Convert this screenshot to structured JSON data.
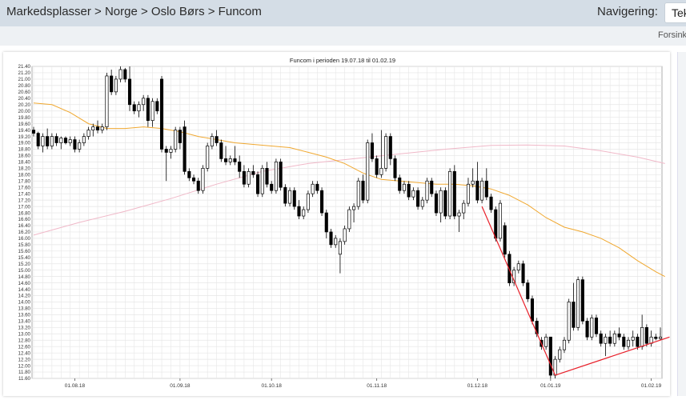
{
  "header": {
    "breadcrumb": "Markedsplasser > Norge > Oslo Børs > Funcom",
    "nav_label": "Navigering:",
    "nav_value": "Tek",
    "sub_link": "Forsink"
  },
  "chart_data": {
    "type": "candlestick",
    "title": "Funcom i perioden 19.07.18 til 01.02.19",
    "ylim": [
      11.6,
      21.4
    ],
    "y_ticks": [
      "11.60",
      "11.80",
      "12.00",
      "12.20",
      "12.40",
      "12.60",
      "12.80",
      "13.00",
      "13.20",
      "13.40",
      "13.60",
      "13.80",
      "14.00",
      "14.20",
      "14.40",
      "14.60",
      "14.80",
      "15.00",
      "15.20",
      "15.40",
      "15.60",
      "15.80",
      "16.00",
      "16.20",
      "16.40",
      "16.60",
      "16.80",
      "17.00",
      "17.20",
      "17.40",
      "17.60",
      "17.80",
      "18.00",
      "18.20",
      "18.40",
      "18.60",
      "18.80",
      "19.00",
      "19.20",
      "19.40",
      "19.60",
      "19.80",
      "20.00",
      "20.20",
      "20.40",
      "20.60",
      "20.80",
      "21.00",
      "21.20",
      "21.40"
    ],
    "x_ticks": [
      {
        "i": 9,
        "label": "01.08.18"
      },
      {
        "i": 32,
        "label": "01.09.18"
      },
      {
        "i": 52,
        "label": "01.10.18"
      },
      {
        "i": 75,
        "label": "01.11.18"
      },
      {
        "i": 97,
        "label": "01.12.18"
      },
      {
        "i": 113,
        "label": "01.01.19"
      },
      {
        "i": 135,
        "label": "01.02.19"
      }
    ],
    "grid": true,
    "colors": {
      "up": "#ffffff",
      "down": "#000000",
      "ma_short": "#f0a830",
      "ma_long": "#f0b8c8",
      "trend": "#e8202a",
      "grid": "#e6e6e6"
    },
    "ohlc": [
      {
        "o": 19.4,
        "h": 19.5,
        "l": 19.2,
        "c": 19.3
      },
      {
        "o": 19.3,
        "h": 19.35,
        "l": 18.8,
        "c": 18.9
      },
      {
        "o": 18.9,
        "h": 19.3,
        "l": 18.7,
        "c": 19.2
      },
      {
        "o": 19.2,
        "h": 19.45,
        "l": 18.8,
        "c": 18.9
      },
      {
        "o": 18.9,
        "h": 19.3,
        "l": 18.8,
        "c": 19.2
      },
      {
        "o": 19.2,
        "h": 19.3,
        "l": 18.9,
        "c": 19.0
      },
      {
        "o": 19.0,
        "h": 19.2,
        "l": 18.8,
        "c": 19.15
      },
      {
        "o": 19.15,
        "h": 19.2,
        "l": 18.95,
        "c": 19.0
      },
      {
        "o": 19.0,
        "h": 19.2,
        "l": 18.9,
        "c": 19.1
      },
      {
        "o": 19.1,
        "h": 19.2,
        "l": 18.7,
        "c": 18.8
      },
      {
        "o": 18.8,
        "h": 19.1,
        "l": 18.7,
        "c": 19.0
      },
      {
        "o": 19.0,
        "h": 19.3,
        "l": 18.9,
        "c": 19.2
      },
      {
        "o": 19.2,
        "h": 19.5,
        "l": 19.1,
        "c": 19.4
      },
      {
        "o": 19.4,
        "h": 19.6,
        "l": 19.2,
        "c": 19.5
      },
      {
        "o": 19.5,
        "h": 19.7,
        "l": 19.3,
        "c": 19.4
      },
      {
        "o": 19.4,
        "h": 19.6,
        "l": 19.3,
        "c": 19.5
      },
      {
        "o": 19.5,
        "h": 21.2,
        "l": 19.4,
        "c": 21.1
      },
      {
        "o": 21.1,
        "h": 21.3,
        "l": 20.5,
        "c": 20.6
      },
      {
        "o": 20.6,
        "h": 21.1,
        "l": 20.5,
        "c": 21.0
      },
      {
        "o": 21.0,
        "h": 21.4,
        "l": 20.9,
        "c": 21.3
      },
      {
        "o": 21.3,
        "h": 21.35,
        "l": 20.9,
        "c": 21.0
      },
      {
        "o": 21.0,
        "h": 21.4,
        "l": 20.0,
        "c": 20.2
      },
      {
        "o": 20.2,
        "h": 20.3,
        "l": 19.9,
        "c": 20.0
      },
      {
        "o": 20.0,
        "h": 20.3,
        "l": 19.8,
        "c": 20.2
      },
      {
        "o": 20.2,
        "h": 20.5,
        "l": 20.0,
        "c": 20.4
      },
      {
        "o": 20.4,
        "h": 20.5,
        "l": 19.5,
        "c": 19.7
      },
      {
        "o": 19.7,
        "h": 20.4,
        "l": 19.5,
        "c": 20.3
      },
      {
        "o": 20.3,
        "h": 20.4,
        "l": 19.9,
        "c": 20.0
      },
      {
        "o": 21.0,
        "h": 21.1,
        "l": 18.7,
        "c": 18.8
      },
      {
        "o": 18.8,
        "h": 18.9,
        "l": 17.8,
        "c": 18.7
      },
      {
        "o": 18.7,
        "h": 18.9,
        "l": 18.5,
        "c": 18.8
      },
      {
        "o": 18.8,
        "h": 19.5,
        "l": 18.7,
        "c": 19.4
      },
      {
        "o": 19.4,
        "h": 19.5,
        "l": 18.8,
        "c": 19.0
      },
      {
        "o": 19.5,
        "h": 19.7,
        "l": 18.0,
        "c": 18.1
      },
      {
        "o": 18.1,
        "h": 18.2,
        "l": 17.8,
        "c": 17.9
      },
      {
        "o": 17.9,
        "h": 18.0,
        "l": 17.7,
        "c": 17.8
      },
      {
        "o": 17.8,
        "h": 17.9,
        "l": 17.4,
        "c": 17.5
      },
      {
        "o": 17.5,
        "h": 18.3,
        "l": 17.4,
        "c": 18.2
      },
      {
        "o": 18.2,
        "h": 19.0,
        "l": 18.1,
        "c": 18.9
      },
      {
        "o": 18.9,
        "h": 19.3,
        "l": 18.8,
        "c": 19.2
      },
      {
        "o": 19.2,
        "h": 19.4,
        "l": 18.9,
        "c": 19.0
      },
      {
        "o": 19.0,
        "h": 19.1,
        "l": 18.4,
        "c": 18.5
      },
      {
        "o": 18.5,
        "h": 18.9,
        "l": 18.3,
        "c": 18.4
      },
      {
        "o": 18.4,
        "h": 18.6,
        "l": 18.3,
        "c": 18.5
      },
      {
        "o": 18.5,
        "h": 18.9,
        "l": 18.3,
        "c": 18.4
      },
      {
        "o": 18.4,
        "h": 18.6,
        "l": 17.9,
        "c": 18.1
      },
      {
        "o": 18.1,
        "h": 18.3,
        "l": 17.6,
        "c": 17.7
      },
      {
        "o": 17.7,
        "h": 18.2,
        "l": 17.6,
        "c": 18.1
      },
      {
        "o": 18.1,
        "h": 18.3,
        "l": 17.9,
        "c": 18.0
      },
      {
        "o": 18.0,
        "h": 18.1,
        "l": 17.3,
        "c": 17.4
      },
      {
        "o": 17.4,
        "h": 18.3,
        "l": 17.3,
        "c": 18.2
      },
      {
        "o": 18.2,
        "h": 18.4,
        "l": 17.6,
        "c": 17.7
      },
      {
        "o": 17.7,
        "h": 17.8,
        "l": 17.4,
        "c": 17.5
      },
      {
        "o": 17.5,
        "h": 18.5,
        "l": 17.4,
        "c": 18.4
      },
      {
        "o": 18.4,
        "h": 18.5,
        "l": 17.5,
        "c": 17.6
      },
      {
        "o": 17.6,
        "h": 17.7,
        "l": 17.0,
        "c": 17.1
      },
      {
        "o": 17.1,
        "h": 17.6,
        "l": 17.0,
        "c": 17.5
      },
      {
        "o": 17.5,
        "h": 17.6,
        "l": 16.9,
        "c": 17.0
      },
      {
        "o": 17.0,
        "h": 17.2,
        "l": 16.6,
        "c": 16.7
      },
      {
        "o": 16.7,
        "h": 17.0,
        "l": 16.6,
        "c": 16.9
      },
      {
        "o": 16.9,
        "h": 17.5,
        "l": 16.8,
        "c": 17.4
      },
      {
        "o": 17.4,
        "h": 17.8,
        "l": 17.3,
        "c": 17.7
      },
      {
        "o": 17.7,
        "h": 17.8,
        "l": 17.4,
        "c": 17.5
      },
      {
        "o": 17.5,
        "h": 17.6,
        "l": 16.7,
        "c": 16.8
      },
      {
        "o": 16.8,
        "h": 16.9,
        "l": 16.0,
        "c": 16.2
      },
      {
        "o": 16.2,
        "h": 16.3,
        "l": 15.7,
        "c": 15.8
      },
      {
        "o": 15.8,
        "h": 16.1,
        "l": 15.7,
        "c": 16.0
      },
      {
        "o": 15.5,
        "h": 16.0,
        "l": 14.9,
        "c": 15.9
      },
      {
        "o": 15.9,
        "h": 16.4,
        "l": 15.8,
        "c": 16.3
      },
      {
        "o": 16.3,
        "h": 17.0,
        "l": 16.2,
        "c": 16.9
      },
      {
        "o": 16.9,
        "h": 17.1,
        "l": 16.5,
        "c": 17.0
      },
      {
        "o": 17.0,
        "h": 17.9,
        "l": 16.9,
        "c": 17.8
      },
      {
        "o": 17.8,
        "h": 18.0,
        "l": 17.1,
        "c": 17.2
      },
      {
        "o": 17.2,
        "h": 19.1,
        "l": 17.1,
        "c": 19.0
      },
      {
        "o": 19.0,
        "h": 19.3,
        "l": 18.4,
        "c": 18.5
      },
      {
        "o": 18.5,
        "h": 18.6,
        "l": 17.9,
        "c": 18.0
      },
      {
        "o": 18.0,
        "h": 19.4,
        "l": 17.9,
        "c": 18.2
      },
      {
        "o": 18.2,
        "h": 19.3,
        "l": 18.1,
        "c": 19.2
      },
      {
        "o": 19.2,
        "h": 19.3,
        "l": 18.3,
        "c": 18.5
      },
      {
        "o": 18.5,
        "h": 18.6,
        "l": 17.8,
        "c": 17.9
      },
      {
        "o": 17.9,
        "h": 18.0,
        "l": 17.4,
        "c": 17.5
      },
      {
        "o": 17.5,
        "h": 17.8,
        "l": 17.4,
        "c": 17.7
      },
      {
        "o": 17.7,
        "h": 17.8,
        "l": 17.2,
        "c": 17.3
      },
      {
        "o": 17.3,
        "h": 17.6,
        "l": 17.2,
        "c": 17.5
      },
      {
        "o": 17.5,
        "h": 17.6,
        "l": 16.9,
        "c": 17.0
      },
      {
        "o": 17.0,
        "h": 17.3,
        "l": 16.9,
        "c": 17.2
      },
      {
        "o": 17.2,
        "h": 17.9,
        "l": 17.1,
        "c": 17.8
      },
      {
        "o": 17.8,
        "h": 17.9,
        "l": 17.3,
        "c": 17.4
      },
      {
        "o": 17.4,
        "h": 17.5,
        "l": 16.7,
        "c": 16.8
      },
      {
        "o": 16.8,
        "h": 17.6,
        "l": 16.5,
        "c": 17.5
      },
      {
        "o": 17.5,
        "h": 17.6,
        "l": 16.6,
        "c": 16.7
      },
      {
        "o": 16.7,
        "h": 18.2,
        "l": 16.6,
        "c": 18.1
      },
      {
        "o": 18.1,
        "h": 18.3,
        "l": 16.6,
        "c": 16.7
      },
      {
        "o": 16.7,
        "h": 16.9,
        "l": 16.2,
        "c": 16.8
      },
      {
        "o": 16.8,
        "h": 17.2,
        "l": 16.6,
        "c": 17.1
      },
      {
        "o": 17.1,
        "h": 17.9,
        "l": 17.0,
        "c": 17.7
      },
      {
        "o": 17.7,
        "h": 18.2,
        "l": 17.6,
        "c": 17.8
      },
      {
        "o": 17.8,
        "h": 18.4,
        "l": 17.1,
        "c": 17.2
      },
      {
        "o": 17.2,
        "h": 17.9,
        "l": 17.1,
        "c": 17.8
      },
      {
        "o": 17.8,
        "h": 18.2,
        "l": 17.2,
        "c": 17.3
      },
      {
        "o": 17.3,
        "h": 17.4,
        "l": 16.8,
        "c": 16.9
      },
      {
        "o": 16.9,
        "h": 17.0,
        "l": 15.9,
        "c": 16.0
      },
      {
        "o": 16.0,
        "h": 17.2,
        "l": 15.9,
        "c": 17.1
      },
      {
        "o": 16.4,
        "h": 16.5,
        "l": 15.4,
        "c": 15.5
      },
      {
        "o": 15.5,
        "h": 15.6,
        "l": 14.5,
        "c": 14.6
      },
      {
        "o": 14.6,
        "h": 15.1,
        "l": 14.5,
        "c": 15.0
      },
      {
        "o": 15.0,
        "h": 15.3,
        "l": 14.9,
        "c": 15.2
      },
      {
        "o": 15.2,
        "h": 15.3,
        "l": 14.5,
        "c": 14.6
      },
      {
        "o": 14.6,
        "h": 14.7,
        "l": 14.0,
        "c": 14.1
      },
      {
        "o": 14.1,
        "h": 14.2,
        "l": 13.3,
        "c": 13.4
      },
      {
        "o": 13.4,
        "h": 13.5,
        "l": 12.9,
        "c": 13.0
      },
      {
        "o": 12.8,
        "h": 12.9,
        "l": 12.5,
        "c": 12.6
      },
      {
        "o": 12.6,
        "h": 13.0,
        "l": 12.5,
        "c": 12.9
      },
      {
        "o": 12.9,
        "h": 12.9,
        "l": 11.6,
        "c": 11.7
      },
      {
        "o": 11.7,
        "h": 12.3,
        "l": 11.6,
        "c": 12.2
      },
      {
        "o": 12.2,
        "h": 12.6,
        "l": 12.1,
        "c": 12.5
      },
      {
        "o": 12.5,
        "h": 12.9,
        "l": 12.4,
        "c": 12.8
      },
      {
        "o": 12.8,
        "h": 14.1,
        "l": 12.7,
        "c": 14.0
      },
      {
        "o": 14.0,
        "h": 14.6,
        "l": 13.1,
        "c": 13.2
      },
      {
        "o": 13.2,
        "h": 14.8,
        "l": 13.1,
        "c": 14.7
      },
      {
        "o": 14.7,
        "h": 14.8,
        "l": 13.3,
        "c": 13.4
      },
      {
        "o": 13.4,
        "h": 13.5,
        "l": 12.8,
        "c": 12.9
      },
      {
        "o": 12.9,
        "h": 13.6,
        "l": 12.8,
        "c": 13.5
      },
      {
        "o": 13.5,
        "h": 13.6,
        "l": 12.9,
        "c": 13.0
      },
      {
        "o": 13.0,
        "h": 13.1,
        "l": 12.6,
        "c": 12.7
      },
      {
        "o": 12.7,
        "h": 13.0,
        "l": 12.3,
        "c": 12.9
      },
      {
        "o": 12.9,
        "h": 13.1,
        "l": 12.6,
        "c": 12.7
      },
      {
        "o": 12.7,
        "h": 13.1,
        "l": 12.6,
        "c": 13.0
      },
      {
        "o": 13.0,
        "h": 13.2,
        "l": 12.8,
        "c": 12.9
      },
      {
        "o": 12.9,
        "h": 13.0,
        "l": 12.5,
        "c": 12.6
      },
      {
        "o": 12.6,
        "h": 12.9,
        "l": 12.5,
        "c": 12.8
      },
      {
        "o": 12.8,
        "h": 13.1,
        "l": 12.6,
        "c": 12.9
      },
      {
        "o": 12.9,
        "h": 13.0,
        "l": 12.5,
        "c": 12.6
      },
      {
        "o": 12.6,
        "h": 13.6,
        "l": 12.5,
        "c": 13.2
      },
      {
        "o": 13.2,
        "h": 13.3,
        "l": 12.6,
        "c": 12.7
      },
      {
        "o": 12.7,
        "h": 13.1,
        "l": 12.6,
        "c": 12.9
      },
      {
        "o": 12.9,
        "h": 13.0,
        "l": 12.8,
        "c": 12.85
      },
      {
        "o": 12.85,
        "h": 13.2,
        "l": 12.8,
        "c": 12.9
      }
    ],
    "ma_short": [
      [
        0,
        20.25
      ],
      [
        4,
        20.2
      ],
      [
        8,
        19.95
      ],
      [
        12,
        19.6
      ],
      [
        16,
        19.45
      ],
      [
        20,
        19.45
      ],
      [
        24,
        19.5
      ],
      [
        28,
        19.45
      ],
      [
        32,
        19.35
      ],
      [
        36,
        19.2
      ],
      [
        40,
        19.1
      ],
      [
        44,
        19.0
      ],
      [
        48,
        18.95
      ],
      [
        52,
        18.9
      ],
      [
        56,
        18.85
      ],
      [
        60,
        18.7
      ],
      [
        64,
        18.55
      ],
      [
        68,
        18.35
      ],
      [
        72,
        18.05
      ],
      [
        76,
        17.85
      ],
      [
        80,
        17.8
      ],
      [
        84,
        17.75
      ],
      [
        88,
        17.7
      ],
      [
        92,
        17.7
      ],
      [
        96,
        17.65
      ],
      [
        100,
        17.55
      ],
      [
        104,
        17.35
      ],
      [
        108,
        17.05
      ],
      [
        112,
        16.65
      ],
      [
        116,
        16.35
      ],
      [
        120,
        16.2
      ],
      [
        124,
        16.0
      ],
      [
        128,
        15.7
      ],
      [
        132,
        15.3
      ],
      [
        136,
        14.95
      ],
      [
        138,
        14.8
      ]
    ],
    "ma_long": [
      [
        0,
        16.1
      ],
      [
        10,
        16.5
      ],
      [
        20,
        16.85
      ],
      [
        30,
        17.25
      ],
      [
        40,
        17.7
      ],
      [
        50,
        18.1
      ],
      [
        60,
        18.35
      ],
      [
        70,
        18.5
      ],
      [
        80,
        18.65
      ],
      [
        90,
        18.8
      ],
      [
        100,
        18.92
      ],
      [
        108,
        18.93
      ],
      [
        116,
        18.9
      ],
      [
        124,
        18.75
      ],
      [
        132,
        18.55
      ],
      [
        138,
        18.35
      ]
    ],
    "trendlines": [
      [
        [
          98,
          17.0
        ],
        [
          114,
          11.7
        ]
      ],
      [
        [
          114,
          11.7
        ],
        [
          139,
          12.9
        ]
      ]
    ]
  }
}
